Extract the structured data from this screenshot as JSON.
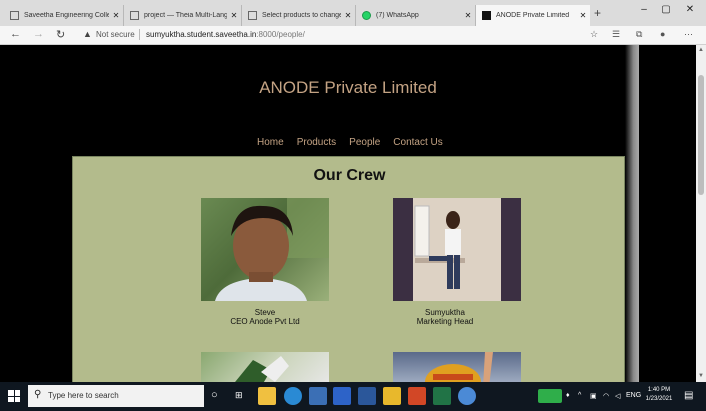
{
  "browser": {
    "tabs": [
      {
        "title": "Saveetha Engineering College",
        "icon": "page-icon"
      },
      {
        "title": "project — Theia Multi-Langua",
        "icon": "page-icon"
      },
      {
        "title": "Select products to change | Dj",
        "icon": "page-icon"
      },
      {
        "title": "(7) WhatsApp",
        "icon": "whatsapp-icon"
      },
      {
        "title": "ANODE Private Limited",
        "icon": "anode-icon",
        "active": true
      }
    ],
    "new_tab_glyph": "+",
    "window_controls": {
      "minimize": "–",
      "maximize": "▢",
      "close": "✕"
    },
    "security_label": "Not secure",
    "url_host": "sumyuktha.student.saveetha.in",
    "url_path": ":8000/people/"
  },
  "site": {
    "title": "ANODE Private Limited",
    "nav": [
      "Home",
      "Products",
      "People",
      "Contact Us"
    ],
    "heading": "Our Crew",
    "members": [
      {
        "name": "Steve",
        "role": "CEO Anode Pvt Ltd"
      },
      {
        "name": "Sumyuktha",
        "role": "Marketing Head"
      }
    ],
    "colors": {
      "background": "#000000",
      "title": "#c4a384",
      "panel": "#b3bb8c"
    }
  },
  "taskbar": {
    "search_placeholder": "Type here to search",
    "language": "ENG",
    "time": "1:40 PM",
    "date": "1/23/2021"
  }
}
